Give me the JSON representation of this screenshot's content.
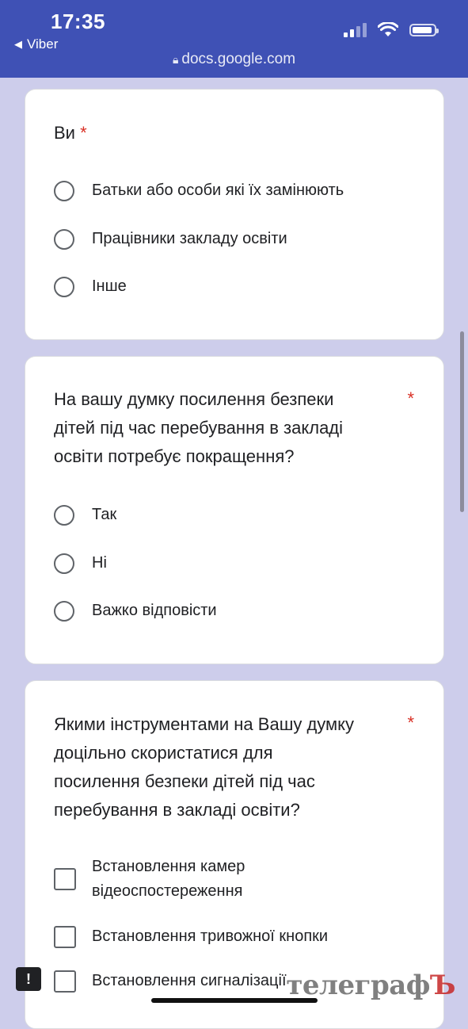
{
  "status_bar": {
    "time": "17:35",
    "back_app": "Viber",
    "url": "docs.google.com"
  },
  "questions": [
    {
      "title": "Ви",
      "required_mark": "*",
      "type": "radio",
      "options": [
        "Батьки або особи які їх замінюють",
        "Працівники закладу освіти",
        "Інше"
      ]
    },
    {
      "title_lines": [
        "На вашу думку посилення безпеки",
        "дітей під час перебування в закладі",
        "освіти потребує покращення?"
      ],
      "required_mark": "*",
      "type": "radio",
      "options": [
        "Так",
        "Ні",
        "Важко відповісти"
      ]
    },
    {
      "title_lines": [
        "Якими інструментами на Вашу думку",
        "доцільно скористатися для",
        "посилення безпеки дітей під час",
        "перебування в закладі освіти?"
      ],
      "required_mark": "*",
      "type": "checkbox",
      "options": [
        {
          "lines": [
            "Встановлення камер",
            "відеоспостереження"
          ]
        },
        {
          "lines": [
            "Встановлення тривожної кнопки"
          ]
        },
        {
          "lines": [
            "Встановлення сигналізації"
          ]
        }
      ]
    }
  ],
  "feedback_icon_glyph": "!",
  "watermark": {
    "text": "телеграф",
    "last": "Ъ"
  },
  "colors": {
    "header": "#3f51b5",
    "background": "#cdcdeb",
    "required": "#d93025"
  }
}
